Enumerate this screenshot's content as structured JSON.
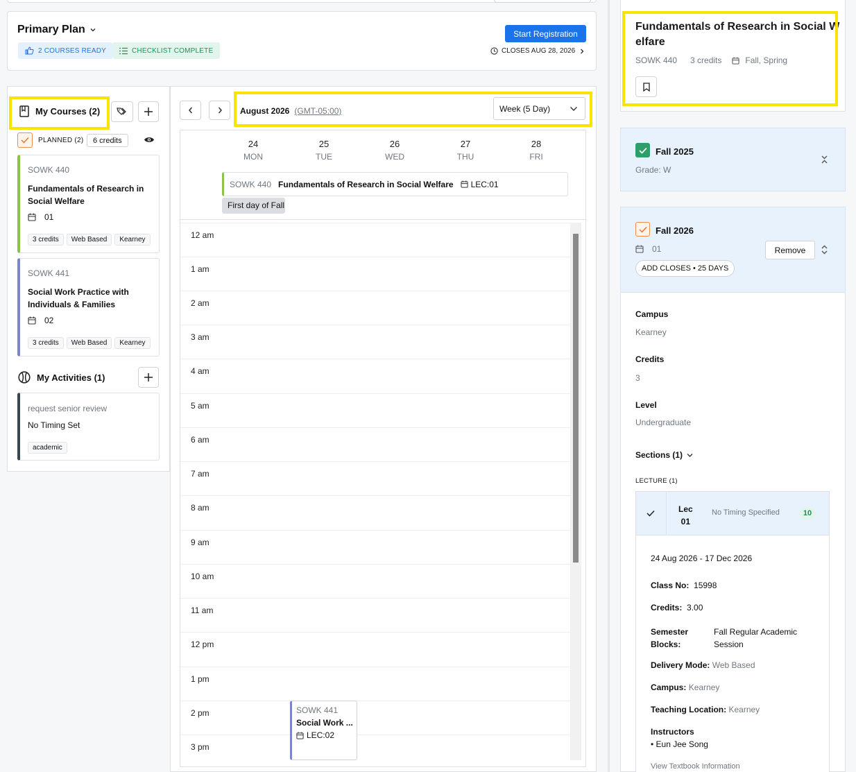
{
  "plan": {
    "title": "Primary Plan",
    "chip_courses": "2 COURSES READY",
    "chip_checklist": "CHECKLIST COMPLETE",
    "start_label": "Start Registration",
    "closes": "CLOSES AUG 28, 2026"
  },
  "sidebar": {
    "my_courses": "My Courses (2)",
    "planned": "PLANNED (2)",
    "credits_total": "6 credits",
    "courses": [
      {
        "code": "SOWK 440",
        "title_l1": "Fundamentals of Research in",
        "title_l2": "Social Welfare",
        "section": "01",
        "tags": [
          "3 credits",
          "Web Based",
          "Kearney"
        ],
        "color": "#8bc34a"
      },
      {
        "code": "SOWK 441",
        "title_l1": "Social Work Practice with",
        "title_l2": "Individuals & Families",
        "section": "02",
        "tags": [
          "3 credits",
          "Web Based",
          "Kearney"
        ],
        "color": "#7986cb"
      }
    ],
    "my_activities": "My Activities (1)",
    "activity": {
      "name": "request senior review",
      "timing": "No Timing Set",
      "tag": "academic"
    }
  },
  "calendar": {
    "month": "August 2026",
    "tz": "(GMT-05:00)",
    "view": "Week (5 Day)",
    "days": [
      {
        "n": "24",
        "w": "MON"
      },
      {
        "n": "25",
        "w": "TUE"
      },
      {
        "n": "26",
        "w": "WED"
      },
      {
        "n": "27",
        "w": "THU"
      },
      {
        "n": "28",
        "w": "FRI"
      }
    ],
    "allday_event": {
      "code": "SOWK 440",
      "title": "Fundamentals of Research in Social Welfare",
      "section": "LEC:01"
    },
    "allday_note": "First day of Fall S",
    "hours": [
      "12 am",
      "1 am",
      "2 am",
      "3 am",
      "4 am",
      "5 am",
      "6 am",
      "7 am",
      "8 am",
      "9 am",
      "10 am",
      "11 am",
      "12 pm",
      "1 pm",
      "2 pm",
      "3 pm"
    ],
    "event2": {
      "code": "SOWK 441",
      "title": "Social Work ...",
      "section": "LEC:02"
    }
  },
  "detail": {
    "title_l1": "Fundamentals of Research in Social W",
    "title_l2": "elfare",
    "code": "SOWK 440",
    "credits": "3 credits",
    "terms": "Fall, Spring",
    "past_term": "Fall 2025",
    "grade": "Grade: W",
    "term": "Fall 2026",
    "section": "01",
    "remove_label": "Remove",
    "add_closes": "ADD CLOSES • 25 DAYS",
    "campus_label": "Campus",
    "campus": "Kearney",
    "credits_label": "Credits",
    "credits_value": "3",
    "level_label": "Level",
    "level": "Undergraduate",
    "sections_label": "Sections (1)",
    "lecture_label": "LECTURE (1)",
    "lec_l1": "Lec",
    "lec_l2": "01",
    "no_timing": "No Timing Specified",
    "seats": "10",
    "dates": "24 Aug 2026 - 17 Dec 2026",
    "class_no_label": "Class No:",
    "class_no": "15998",
    "sec_credits_label": "Credits:",
    "sec_credits": "3.00",
    "semester_label_l1": "Semester",
    "semester_label_l2": "Blocks:",
    "semester_l1": "Fall Regular Academic",
    "semester_l2": "Session",
    "delivery_label": "Delivery Mode:",
    "delivery": "Web Based",
    "sec_campus_label": "Campus:",
    "sec_campus": "Kearney",
    "teaching_label": "Teaching Location:",
    "teaching": "Kearney",
    "instructors_label": "Instructors",
    "instructor": "• Eun Jee Song",
    "textbook": "View Textbook Information"
  }
}
